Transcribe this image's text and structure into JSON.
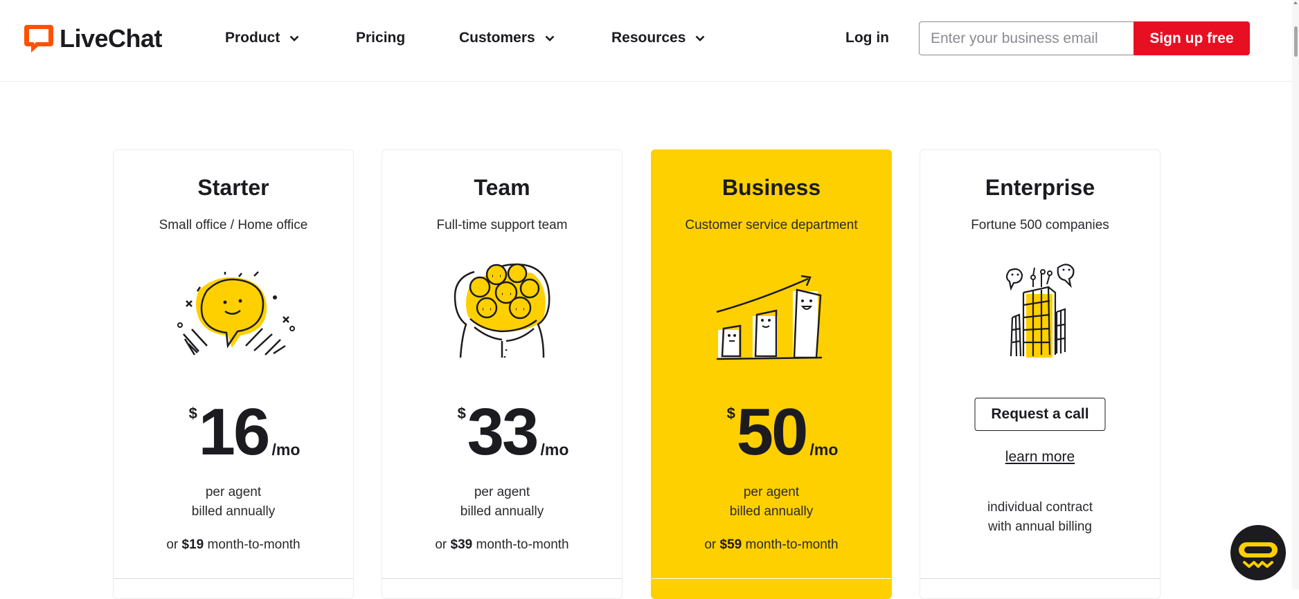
{
  "brand": {
    "name": "LiveChat",
    "accent": "#ff5100",
    "primary": "#e90f23",
    "highlight": "#ffd000"
  },
  "nav": {
    "items": [
      {
        "label": "Product",
        "has_dropdown": true
      },
      {
        "label": "Pricing",
        "has_dropdown": false
      },
      {
        "label": "Customers",
        "has_dropdown": true
      },
      {
        "label": "Resources",
        "has_dropdown": true
      }
    ],
    "login_label": "Log in",
    "email_placeholder": "Enter your business email",
    "email_value": "",
    "signup_label": "Sign up free"
  },
  "plans": [
    {
      "name": "Starter",
      "description": "Small office / Home office",
      "illustration": "happy-chat-bubble-icon",
      "currency": "$",
      "price": "16",
      "period": "/mo",
      "billing_line1": "per agent",
      "billing_line2": "billed annually",
      "alt_prefix": "or",
      "alt_price": "$19",
      "alt_suffix": "month-to-month"
    },
    {
      "name": "Team",
      "description": "Full-time support team",
      "illustration": "team-hug-icon",
      "currency": "$",
      "price": "33",
      "period": "/mo",
      "billing_line1": "per agent",
      "billing_line2": "billed annually",
      "alt_prefix": "or",
      "alt_price": "$39",
      "alt_suffix": "month-to-month"
    },
    {
      "name": "Business",
      "description": "Customer service department",
      "illustration": "growth-chart-icon",
      "currency": "$",
      "price": "50",
      "period": "/mo",
      "billing_line1": "per agent",
      "billing_line2": "billed annually",
      "alt_prefix": "or",
      "alt_price": "$59",
      "alt_suffix": "month-to-month",
      "featured": true
    },
    {
      "name": "Enterprise",
      "description": "Fortune 500 companies",
      "illustration": "skyscrapers-icon",
      "cta_label": "Request a call",
      "link_label": "learn more",
      "contract_line1": "individual contract",
      "contract_line2": "with annual billing"
    }
  ],
  "chat_widget": {
    "icon": "chat-widget-icon"
  }
}
